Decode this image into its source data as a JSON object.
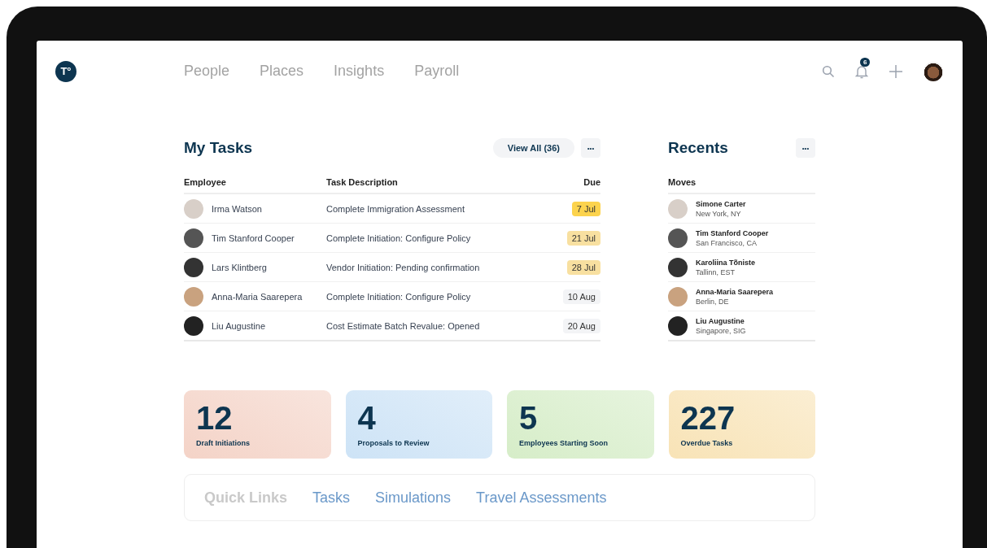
{
  "nav": {
    "logo": "T°",
    "items": [
      {
        "label": "People",
        "selected": false
      },
      {
        "label": "Places",
        "selected": false
      },
      {
        "label": "Insights",
        "selected": false
      },
      {
        "label": "Payroll",
        "selected": false
      }
    ],
    "notifications": "6"
  },
  "tasks": {
    "title": "My Tasks",
    "view_all": "View All (36)",
    "more": "•••",
    "columns": [
      "Employee",
      "Task Description",
      "Due"
    ],
    "rows": [
      {
        "employee": "Irma Watson",
        "task": "Complete Immigration Assessment",
        "due": "7 Jul",
        "color": "#fcd34d"
      },
      {
        "employee": "Tim Stanford Cooper",
        "task": "Complete Initiation: Configure Policy",
        "due": "21 Jul",
        "color": "#f8e0a0"
      },
      {
        "employee": "Lars Klintberg",
        "task": "Vendor Initiation: Pending confirmation",
        "due": "28 Jul",
        "color": "#f8e0a0"
      },
      {
        "employee": "Anna-Maria Saarepera",
        "task": "Complete Initiation: Configure Policy",
        "due": "10 Aug",
        "color": "#f3f4f6"
      },
      {
        "employee": "Liu Augustine",
        "task": "Cost Estimate Batch Revalue: Opened",
        "due": "20 Aug",
        "color": "#f3f4f6"
      }
    ]
  },
  "recents": {
    "title": "Recents",
    "more": "•••",
    "column": "Moves",
    "rows": [
      {
        "name": "Simone Carter",
        "place": "New York, NY"
      },
      {
        "name": "Tim Stanford Cooper",
        "place": "San Francisco, CA"
      },
      {
        "name": "Karoliina Tõniste",
        "place": "Tallinn, EST"
      },
      {
        "name": "Anna-Maria Saarepera",
        "place": "Berlin, DE"
      },
      {
        "name": "Liu Augustine",
        "place": "Singapore, SIG"
      }
    ]
  },
  "stats": [
    {
      "value": "12",
      "label": "Draft Initiations",
      "color": "#f4d3c7"
    },
    {
      "value": "4",
      "label": "Proposals to Review",
      "color": "#cde3f6"
    },
    {
      "value": "5",
      "label": "Employees Starting Soon",
      "color": "#d6edc8"
    },
    {
      "value": "227",
      "label": "Overdue Tasks",
      "color": "#f8e3b6"
    }
  ],
  "quick_links": {
    "title": "Quick Links",
    "links": [
      "Tasks",
      "Simulations",
      "Travel Assessments"
    ]
  }
}
